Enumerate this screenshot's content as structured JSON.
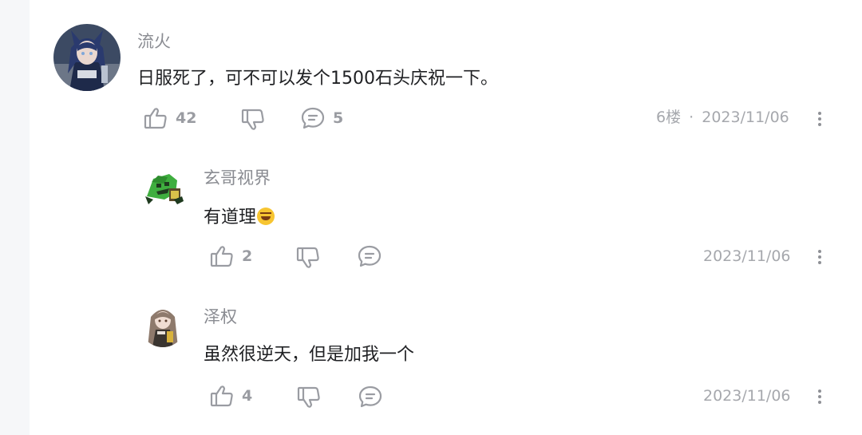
{
  "comments": [
    {
      "author": "流火",
      "text": "日服死了，可不可以发个1500石头庆祝一下。",
      "likes": "42",
      "replies": "5",
      "floor": "6楼",
      "dot": "·",
      "date": "2023/11/06",
      "avatar_colors": {
        "bg": "#3c4a63",
        "hair": "#2a3a6e",
        "skin": "#e9d7cf",
        "accent": "#7fa7d9"
      }
    },
    {
      "author": "玄哥视界",
      "text": "有道理",
      "emoji": "rolling-on-floor-laughing-emoji",
      "likes": "2",
      "date": "2023/11/06",
      "avatar_colors": {
        "bg": "#ffffff",
        "body": "#3fae3f",
        "dark": "#1f3a1f",
        "accent": "#d9c14a"
      }
    },
    {
      "author": "泽权",
      "text": "虽然很逆天，但是加我一个",
      "likes": "4",
      "date": "2023/11/06",
      "avatar_colors": {
        "bg": "#ffffff",
        "hair": "#8e7a6c",
        "coat": "#3a3530",
        "accent": "#d8b23c"
      }
    }
  ],
  "icons": {
    "like": "thumbs-up-icon",
    "dislike": "thumbs-down-icon",
    "reply": "comment-bubble-icon",
    "more": "more-vertical-icon"
  },
  "colors": {
    "name": "#8a8c92",
    "text": "#1f2023",
    "muted": "#a6a8ad",
    "icon": "#9a9ca2",
    "sidebar": "#f6f7f9"
  }
}
